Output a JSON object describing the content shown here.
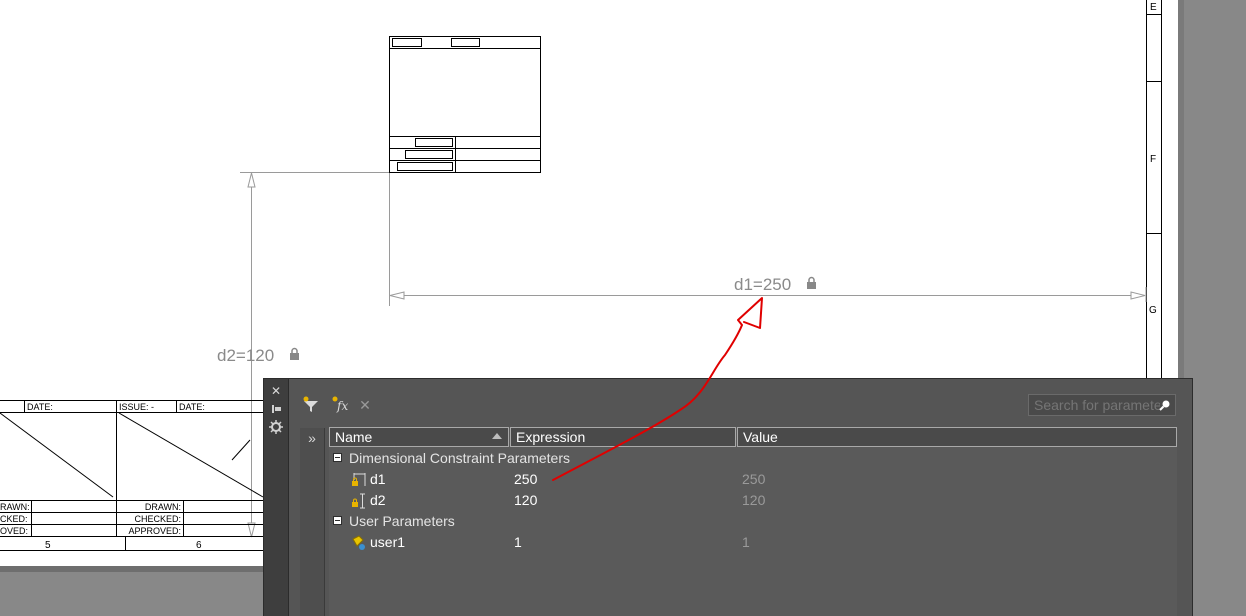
{
  "drawing": {
    "dims": {
      "d1_label": "d1=250",
      "d2_label": "d2=120"
    },
    "zones": [
      "E",
      "F",
      "G"
    ],
    "title_block": {
      "row1": [
        "DATE:",
        "ISSUE: -",
        "DATE:"
      ],
      "row2": [
        [
          "RAWN:",
          "DRAWN:"
        ],
        [
          "CKED:",
          "CHECKED:"
        ],
        [
          "OVED:",
          "APPROVED:"
        ]
      ],
      "bottom_numbers": [
        "5",
        "6"
      ]
    },
    "annotation_color": "#e00000"
  },
  "palette": {
    "strip_icons": [
      "close-icon",
      "autohide-icon",
      "properties-icon"
    ],
    "toolbar_icons": [
      "create-parameter-filter-icon",
      "new-user-parameter-icon",
      "delete-parameter-icon"
    ],
    "search": {
      "placeholder": "Search for parameter"
    },
    "expand_glyph": "»",
    "columns": {
      "name": "Name",
      "expression": "Expression",
      "value": "Value"
    },
    "groups": [
      {
        "label": "Dimensional Constraint Parameters",
        "items": [
          {
            "name": "d1",
            "expression": "250",
            "value": "250",
            "icon": "dimensional-constraint-icon"
          },
          {
            "name": "d2",
            "expression": "120",
            "value": "120",
            "icon": "dimensional-constraint-icon"
          }
        ]
      },
      {
        "label": "User Parameters",
        "items": [
          {
            "name": "user1",
            "expression": "1",
            "value": "1",
            "icon": "user-parameter-icon"
          }
        ]
      }
    ]
  }
}
